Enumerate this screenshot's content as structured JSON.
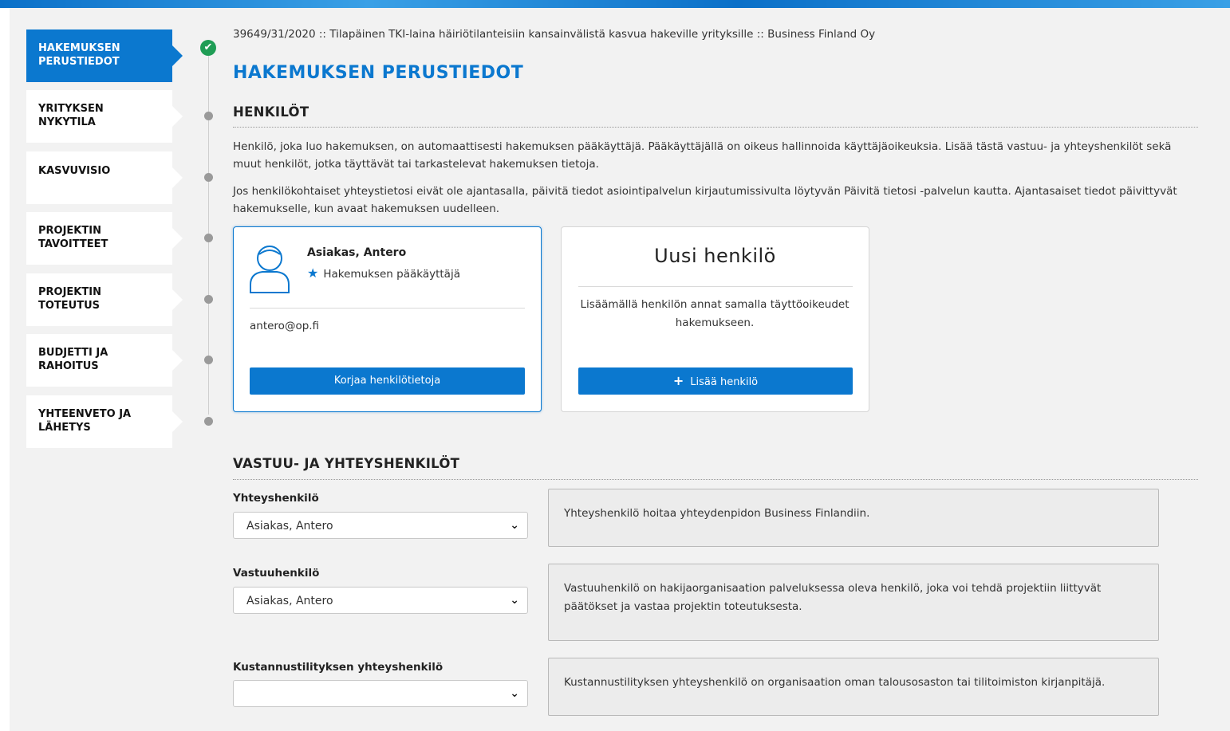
{
  "breadcrumb": "39649/31/2020 :: Tilapäinen TKI-laina häiriötilanteisiin kansainvälistä kasvua hakeville yrityksille :: Business Finland Oy",
  "page_title": "HAKEMUKSEN PERUSTIEDOT",
  "sidebar": {
    "items": [
      {
        "label": "HAKEMUKSEN PERUSTIEDOT",
        "status": "complete"
      },
      {
        "label": "YRITYKSEN NYKYTILA",
        "status": "pending"
      },
      {
        "label": "KASVUVISIO",
        "status": "pending"
      },
      {
        "label": "PROJEKTIN TAVOITTEET",
        "status": "pending"
      },
      {
        "label": "PROJEKTIN TOTEUTUS",
        "status": "pending"
      },
      {
        "label": "BUDJETTI JA RAHOITUS",
        "status": "pending"
      },
      {
        "label": "YHTEENVETO JA LÄHETYS",
        "status": "pending"
      }
    ],
    "check_icon": "✔"
  },
  "persons_section": {
    "title": "HENKILÖT",
    "para1": "Henkilö, joka luo hakemuksen, on automaattisesti hakemuksen pääkäyttäjä. Pääkäyttäjällä on oikeus hallinnoida käyttäjäoikeuksia. Lisää tästä vastuu- ja yhteyshenkilöt sekä muut henkilöt, jotka täyttävät tai tarkastelevat hakemuksen tietoja.",
    "para2": "Jos henkilökohtaiset yhteystietosi eivät ole ajantasalla, päivitä tiedot asiointipalvelun kirjautumissivulta löytyvän Päivitä tietosi -palvelun kautta. Ajantasaiset tiedot päivittyvät hakemukselle, kun avaat hakemuksen uudelleen."
  },
  "person_card": {
    "name": "Asiakas, Antero",
    "role": "Hakemuksen pääkäyttäjä",
    "email": "antero@op.fi",
    "edit_button": "Korjaa henkilötietoja"
  },
  "new_person_card": {
    "title": "Uusi henkilö",
    "description": "Lisäämällä henkilön annat samalla täyttöoikeudet hakemukseen.",
    "add_button": "Lisää henkilö"
  },
  "contacts_section": {
    "title": "VASTUU- JA YHTEYSHENKILÖT",
    "fields": [
      {
        "label": "Yhteyshenkilö",
        "value": "Asiakas, Antero",
        "info": "Yhteyshenkilö hoitaa yhteydenpidon Business Finlandiin."
      },
      {
        "label": "Vastuuhenkilö",
        "value": "Asiakas, Antero",
        "info": "Vastuuhenkilö on hakijaorganisaation palveluksessa oleva henkilö, joka voi tehdä projektiin liittyvät päätökset ja vastaa projektin toteutuksesta."
      },
      {
        "label": "Kustannustilityksen yhteyshenkilö",
        "value": "",
        "info": "Kustannustilityksen yhteyshenkilö on organisaation oman talousosaston tai tilitoimiston kirjanpitäjä."
      }
    ]
  },
  "colors": {
    "accent": "#0b78cf",
    "success": "#1f9d55"
  }
}
